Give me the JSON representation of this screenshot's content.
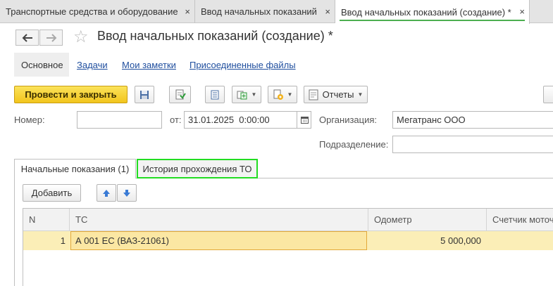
{
  "window_tabs": [
    {
      "label": "Транспортные средства и оборудование",
      "close": "×"
    },
    {
      "label": "Ввод начальных показаний",
      "close": "×"
    },
    {
      "label": "Ввод начальных показаний (создание) *",
      "close": "×"
    }
  ],
  "nav": {
    "back_icon": "arrow-left-icon",
    "forward_icon": "arrow-right-icon",
    "favorite_icon": "star-icon"
  },
  "form": {
    "title": "Ввод начальных показаний (создание) *"
  },
  "sections": {
    "main": "Основное",
    "tasks": "Задачи",
    "notes": "Мои заметки",
    "files": "Присоединенные файлы"
  },
  "toolbar": {
    "post_close": "Провести и закрыть",
    "reports": "Отчеты"
  },
  "fields": {
    "number_label": "Номер:",
    "number_value": "",
    "date_label": "от:",
    "date_value": "31.01.2025  0:00:00",
    "org_label": "Организация:",
    "org_value": "Мегатранс ООО",
    "dept_label": "Подразделение:",
    "dept_value": ""
  },
  "content_tabs": {
    "initial": "Начальные показания (1)",
    "history": "История прохождения ТО"
  },
  "table_toolbar": {
    "add": "Добавить"
  },
  "table": {
    "columns": {
      "n": "N",
      "vehicle": "ТС",
      "odometer": "Одометр",
      "engine_hours": "Счетчик моточ"
    },
    "rows": [
      {
        "n": "1",
        "vehicle": "А 001 ЕС (ВАЗ-21061)",
        "odometer": "5 000,000",
        "engine_hours": ""
      }
    ]
  },
  "colors": {
    "accent_green": "#22dd22",
    "primary_yellow": "#f2c51d",
    "row_highlight": "#fbeeb7",
    "link_blue": "#1f4e9e"
  }
}
